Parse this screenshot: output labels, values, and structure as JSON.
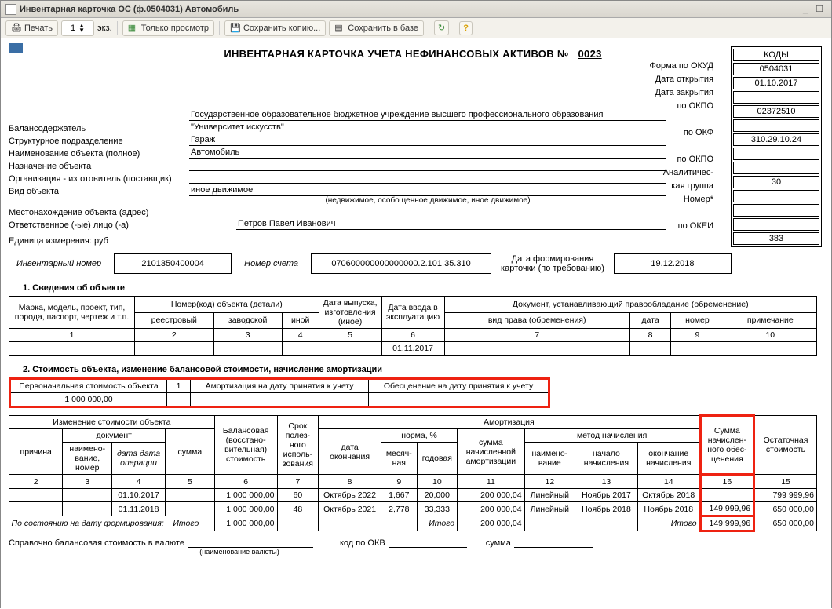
{
  "window": {
    "title": "Инвентарная карточка ОС (ф.0504031) Автомобиль"
  },
  "toolbar": {
    "print": "Печать",
    "copies": "1",
    "unit": "экз.",
    "view_only": "Только просмотр",
    "save_copy": "Сохранить копию...",
    "save_db": "Сохранить в базе"
  },
  "doc": {
    "title_prefix": "ИНВЕНТАРНАЯ КАРТОЧКА УЧЕТА НЕФИНАНСОВЫХ АКТИВОВ    №",
    "number": "0023"
  },
  "right": {
    "labels": [
      "",
      "Форма по ОКУД",
      "Дата открытия",
      "Дата закрытия",
      "по ОКПО",
      "",
      "по ОКФ",
      "",
      "по ОКПО",
      "Аналитичес-",
      "кая группа",
      "Номер*",
      "",
      "по ОКЕИ"
    ],
    "codes_hdr": "КОДЫ",
    "codes": [
      "0504031",
      "01.10.2017",
      "",
      "02372510",
      "",
      "310.29.10.24",
      "",
      "",
      "30",
      "",
      "",
      "",
      "383"
    ]
  },
  "fields": {
    "holder_l": "Балансодержатель",
    "holder_v1": "Государственное образовательное бюджетное учреждение высшего профессионального образования",
    "holder_v2": "\"Университет искусств\"",
    "dept_l": "Структурное подразделение",
    "dept_v": "Гараж",
    "name_l": "Наименование объекта (полное)",
    "name_v": "Автомобиль",
    "purpose_l": "Назначение объекта",
    "purpose_v": "",
    "maker_l": "Организация - изготовитель (поставщик)",
    "maker_v": "",
    "kind_l": "Вид объекта",
    "kind_v": "иное движимое",
    "kind_hint": "(недвижимое, особо ценное движимое, иное движимое)",
    "loc_l": "Местонахождение объекта (адрес)",
    "loc_v": "",
    "resp_l": "Ответственное (-ые) лицо (-а)",
    "resp_v": "Петров Павел Иванович",
    "unit_l": "Единица измерения: руб"
  },
  "info": {
    "inv_l": "Инвентарный номер",
    "inv_v": "2101350400004",
    "acc_l": "Номер счета",
    "acc_v": "070600000000000000.2.101.35.310",
    "date_l1": "Дата формирования",
    "date_l2": "карточки (по требованию)",
    "date_v": "19.12.2018"
  },
  "sect1": "1. Сведения об объекте",
  "t1": {
    "h": [
      "Марка, модель, проект, тип, порода, паспорт, чертеж и т.п.",
      "Номер(код) объекта (детали)",
      "Дата выпуска, изготовления (иное)",
      "Дата ввода в эксплуатацию",
      "Документ, устанавливающий правообладание (обременение)"
    ],
    "h2": [
      "реестровый",
      "заводской",
      "иной",
      "вид права (обременения)",
      "дата",
      "номер",
      "примечание"
    ],
    "nums": [
      "1",
      "2",
      "3",
      "4",
      "5",
      "6",
      "7",
      "8",
      "9",
      "10"
    ],
    "row": [
      "",
      "",
      "",
      "",
      "",
      "01.11.2017",
      "",
      "",
      "",
      ""
    ]
  },
  "sect2": "2. Стоимость объекта, изменение балансовой стоимости, начисление амортизации",
  "t2a": {
    "h": [
      "Первоначальная стоимость объекта",
      "1",
      "Амортизация на дату принятия к учету",
      "Обесценение на дату принятия к учету"
    ],
    "v": [
      "1 000 000,00",
      "",
      "",
      ""
    ]
  },
  "t2b": {
    "h1": [
      "Изменение стоимости объекта",
      "Балансовая (восстано-вительная) стоимость",
      "Срок полез-ного исполь-зования",
      "Амортизация",
      "Сумма начислен-ного обес-ценения",
      "Остаточная стоимость"
    ],
    "h2": [
      "причина",
      "документ",
      "сумма",
      "дата окончания",
      "норма, %",
      "сумма начисленной амортизации",
      "метод начисления"
    ],
    "h3": [
      "наимено-вание, номер",
      "дата дата операции",
      "месяч-ная",
      "годовая",
      "наимено-вание",
      "начало начисления",
      "окончание начисления"
    ],
    "nums": [
      "2",
      "3",
      "4",
      "5",
      "6",
      "7",
      "8",
      "9",
      "10",
      "11",
      "12",
      "13",
      "14",
      "16",
      "15"
    ],
    "rows": [
      [
        "",
        "",
        "01.10.2017",
        "",
        "1 000 000,00",
        "60",
        "Октябрь 2022",
        "1,667",
        "20,000",
        "200 000,04",
        "Линейный",
        "Ноябрь 2017",
        "Октябрь 2018",
        "",
        "799 999,96"
      ],
      [
        "",
        "",
        "01.11.2018",
        "",
        "1 000 000,00",
        "48",
        "Октябрь 2021",
        "2,778",
        "33,333",
        "200 000,04",
        "Линейный",
        "Ноябрь 2018",
        "Ноябрь 2018",
        "149 999,96",
        "650 000,00"
      ]
    ],
    "tot_l": "По состоянию на дату формирования:",
    "tot": [
      "Итого",
      "1 000 000,00",
      "",
      "",
      "",
      "",
      "Итого",
      "200 000,04",
      "",
      "",
      "Итого",
      "149 999,96",
      "650 000,00"
    ]
  },
  "footer": {
    "bal_l": "Справочно балансовая стоимость в валюте",
    "name_hint": "(наименование валюты)",
    "okv": "код по ОКВ",
    "sum": "сумма"
  }
}
